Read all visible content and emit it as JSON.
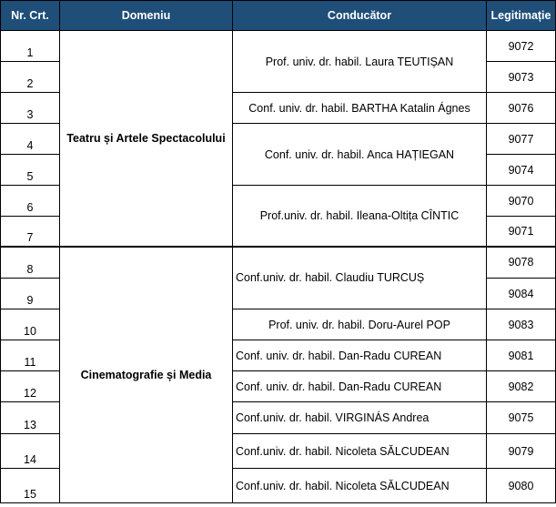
{
  "headers": {
    "nr": "Nr. Crt.",
    "domeniu": "Domeniu",
    "conducator": "Conducător",
    "legitimatie": "Legitimație"
  },
  "domains": [
    "Teatru și Artele Spectacolului",
    "Cinematografie și Media"
  ],
  "row_numbers": [
    "1",
    "2",
    "3",
    "4",
    "5",
    "6",
    "7",
    "8",
    "9",
    "10",
    "11",
    "12",
    "13",
    "14",
    "15"
  ],
  "supervisors": [
    "Prof. univ. dr. habil. Laura TEUTIȘAN",
    "Conf. univ. dr. habil. BARTHA Katalin Ágnes",
    "Conf. univ. dr. habil. Anca HAȚIEGAN",
    "Prof.univ. dr. habil. Ileana-Oltița CÎNTIC",
    "Conf.univ. dr. habil. Claudiu TURCUȘ",
    "Prof. univ. dr. habil. Doru-Aurel POP",
    "Conf. univ. dr. habil. Dan-Radu CUREAN",
    "Conf. univ. dr. habil. Dan-Radu CUREAN",
    "Conf.univ. dr. habil. VIRGINÁS Andrea",
    "Conf.univ. dr. habil. Nicoleta SĂLCUDEAN",
    "Conf.univ. dr. habil. Nicoleta SĂLCUDEAN"
  ],
  "legitimations": [
    "9072",
    "9073",
    "9076",
    "9077",
    "9074",
    "9070",
    "9071",
    "9078",
    "9084",
    "9083",
    "9081",
    "9082",
    "9075",
    "9079",
    "9080"
  ]
}
